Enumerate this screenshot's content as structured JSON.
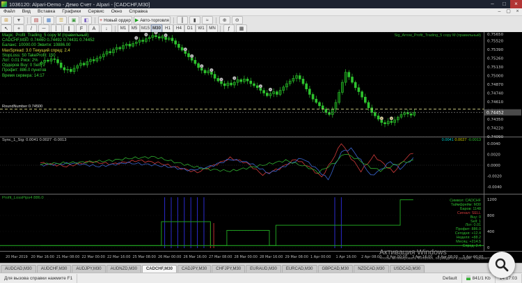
{
  "window": {
    "title": "1036120: Alpari-Demo - Демо Счет - Alpari - [CADCHF,M30]"
  },
  "menu": {
    "items": [
      "Файл",
      "Вид",
      "Вставка",
      "Графики",
      "Сервис",
      "Окно",
      "Справка"
    ]
  },
  "toolbar1": {
    "groups": [
      [
        {
          "n": "new-chart-button",
          "g": "⊞",
          "c": "#c9962f"
        },
        {
          "n": "profiles-button",
          "g": "▼",
          "c": "#666"
        }
      ],
      [
        {
          "n": "market-watch-button",
          "g": "▤",
          "c": "#b03030"
        },
        {
          "n": "data-window-button",
          "g": "▦",
          "c": "#3f7ac9"
        },
        {
          "n": "navigator-button",
          "g": "☰",
          "c": "#c9a52f"
        },
        {
          "n": "terminal-button",
          "g": "▣",
          "c": "#3f9a3f"
        },
        {
          "n": "strategy-tester-button",
          "g": "◧",
          "c": "#7a5fc0"
        }
      ],
      [
        {
          "n": "new-order-button",
          "g": "+",
          "c": "#c03030",
          "label": "Новый ордер"
        },
        {
          "n": "autotrade-button",
          "g": "▶",
          "c": "#18a018",
          "label": "Авто-торговля"
        }
      ],
      [
        {
          "n": "bars-chart-button",
          "g": "║",
          "c": "#444"
        },
        {
          "n": "candles-chart-button",
          "g": "▮",
          "c": "#444"
        },
        {
          "n": "line-chart-button",
          "g": "≈",
          "c": "#444"
        }
      ],
      [
        {
          "n": "zoom-in-button",
          "g": "⊕",
          "c": "#444"
        },
        {
          "n": "zoom-out-button",
          "g": "⊖",
          "c": "#444"
        }
      ]
    ]
  },
  "toolbar2": {
    "icons": [
      {
        "n": "cursor-button",
        "g": "↖"
      },
      {
        "n": "crosshair-button",
        "g": "+"
      },
      {
        "n": "trendline-button",
        "g": "/"
      },
      {
        "n": "hline-button",
        "g": "─"
      },
      {
        "n": "vline-button",
        "g": "│"
      },
      {
        "n": "channel-button",
        "g": "∥"
      },
      {
        "n": "fibonacci-button",
        "g": "F"
      },
      {
        "n": "text-button",
        "g": "A"
      },
      {
        "n": "arrows-button",
        "g": "↓"
      }
    ],
    "timeframes": [
      "M1",
      "M5",
      "M15",
      "M30",
      "H1",
      "H4",
      "D1",
      "W1",
      "MN"
    ],
    "active_timeframe": "M30",
    "right_icons": [
      {
        "n": "indicators-button",
        "g": "ƒ"
      },
      {
        "n": "templates-button",
        "g": "▦"
      }
    ]
  },
  "chart": {
    "overlay_lines": [
      {
        "text": "Magic_Profit_Trading_5 copy M (правильный)",
        "color": "#3ddc3d"
      },
      {
        "text": "CADCHF,M30: 0.74460 0.74492 0.74431 0.74452",
        "color": "#3ddc3d"
      },
      {
        "text": "Баланс: 10000.00  Эквити: 10886.00",
        "color": "#3ddc3d"
      },
      {
        "text": "MaxSpread: 3.0  Текущий спред: 2.4",
        "color": "#dede3c"
      },
      {
        "text": "StopLoss: 50  TakeProfit: 150",
        "color": "#3ddc3d"
      },
      {
        "text": "Лот: 0.01  Риск: 2%",
        "color": "#3ddc3d"
      },
      {
        "text": "Ордеров Buy: 0  Sell: 1",
        "color": "#3ddc3d"
      },
      {
        "text": "Профит: 886.0 пунктов",
        "color": "#3ddc3d"
      },
      {
        "text": "Время сервера: 14:17",
        "color": "#3ddc3d"
      }
    ],
    "top_right_label": "Sig_Arrow_Profit_Trading_5 copy M (правильный)",
    "round_line_label": "RoundNumber 0.74500",
    "round_line_price": 0.745,
    "current_price": "0.74452",
    "current_price_value": 0.74452,
    "price_ticks": [
      "0.75650",
      "0.75520",
      "0.75390",
      "0.75260",
      "0.75130",
      "0.75000",
      "0.74870",
      "0.74740",
      "0.74610",
      "0.74480",
      "0.74350",
      "0.74220",
      "0.74090"
    ],
    "price_max": 0.7565,
    "price_min": 0.7409,
    "time_ticks": [
      "20 Mar 2019",
      "20 Mar 16:00",
      "21 Mar 08:00",
      "22 Mar 00:00",
      "22 Mar 16:00",
      "25 Mar 08:00",
      "26 Mar 00:00",
      "26 Mar 16:00",
      "27 Mar 08:00",
      "28 Mar 00:00",
      "28 Mar 16:00",
      "29 Mar 08:00",
      "1 Apr 00:00",
      "1 Apr 16:00",
      "2 Apr 08:00",
      "3 Apr 00:00",
      "3 Apr 16:00",
      "4 Apr 08:00",
      "5 Apr 00:00"
    ],
    "closes": [
      0.752,
      0.7523,
      0.75215,
      0.7525,
      0.7524,
      0.7519,
      0.7512,
      0.75085,
      0.75095,
      0.7506,
      0.7511,
      0.7515,
      0.75185,
      0.7516,
      0.7521,
      0.7524,
      0.7522,
      0.7526,
      0.7528,
      0.7532,
      0.7536,
      0.7534,
      0.7539,
      0.7542,
      0.754,
      0.7545,
      0.7547,
      0.7544,
      0.7548,
      0.755,
      0.7553,
      0.7551,
      0.7555,
      0.7557,
      0.756,
      0.7558,
      0.7556,
      0.7559,
      0.7554,
      0.7556,
      0.7552,
      0.7547,
      0.7542,
      0.7538,
      0.7533,
      0.7528,
      0.7523,
      0.7518,
      0.7512,
      0.7508,
      0.7504,
      0.7507,
      0.7502,
      0.7496,
      0.7492,
      0.7488,
      0.7485,
      0.7489,
      0.7486,
      0.749,
      0.7494,
      0.7491,
      0.7495,
      0.7492,
      0.7488,
      0.7485,
      0.7482,
      0.7478,
      0.7474,
      0.747,
      0.7473,
      0.7476,
      0.7472,
      0.7478,
      0.7483,
      0.7488,
      0.7492,
      0.7496,
      0.75,
      0.7495,
      0.7488,
      0.748,
      0.7472,
      0.7465,
      0.746,
      0.7455,
      0.745,
      0.7445,
      0.7442,
      0.745,
      0.746,
      0.7475,
      0.749,
      0.7505,
      0.7498,
      0.749,
      0.7482,
      0.7476,
      0.7468,
      0.746,
      0.7452,
      0.7445,
      0.744,
      0.7435,
      0.743,
      0.7428,
      0.7432,
      0.743,
      0.7434,
      0.7438,
      0.7442,
      0.7445,
      0.7443,
      0.7441,
      0.74452
    ],
    "markers": [
      {
        "i": 29
      },
      {
        "i": 32
      },
      {
        "i": 35
      },
      {
        "i": 38
      },
      {
        "i": 44
      },
      {
        "i": 46
      },
      {
        "i": 49
      },
      {
        "i": 52
      },
      {
        "i": 55
      },
      {
        "i": 59
      },
      {
        "i": 67
      },
      {
        "i": 70
      },
      {
        "i": 104,
        "c": "gold"
      },
      {
        "i": 107,
        "c": "gold"
      }
    ],
    "candle_color": "#2ec22e",
    "marker_color": "#cfcfcf",
    "marker_gold": "#e8dc9a"
  },
  "win1": {
    "label": "Sync_1_Sig: 0.0041 0.0027 -0.0013",
    "values": [
      {
        "text": "0.0041",
        "color": "#00d0d0"
      },
      {
        "text": "0.0027",
        "color": "#d0d000"
      },
      {
        "text": "-0.0013",
        "color": "#30c030"
      }
    ],
    "ticks": [
      "0.0040",
      "0.0020",
      "0.0000",
      "-0.0020",
      "-0.0040"
    ],
    "series": {
      "red": [
        [
          0,
          0.1
        ],
        [
          8,
          -0.05
        ],
        [
          15,
          0.15
        ],
        [
          22,
          0.05
        ],
        [
          30,
          0.2
        ],
        [
          36,
          0.1
        ],
        [
          42,
          -0.1
        ],
        [
          48,
          -0.3
        ],
        [
          54,
          0.05
        ],
        [
          58,
          0.3
        ],
        [
          63,
          0.1
        ],
        [
          68,
          -0.4
        ],
        [
          73,
          -0.15
        ],
        [
          78,
          0.25
        ],
        [
          82,
          -0.05
        ],
        [
          86,
          -0.5
        ],
        [
          90,
          0.4
        ],
        [
          92,
          0.95
        ],
        [
          95,
          0.3
        ],
        [
          98,
          -0.25
        ],
        [
          102,
          0.4
        ],
        [
          105,
          0.05
        ],
        [
          108,
          -0.3
        ],
        [
          111,
          0.2
        ],
        [
          114,
          0.55
        ]
      ],
      "blue": [
        [
          0,
          0.0
        ],
        [
          10,
          0.08
        ],
        [
          18,
          -0.05
        ],
        [
          26,
          0.1
        ],
        [
          34,
          0.02
        ],
        [
          40,
          -0.08
        ],
        [
          46,
          -0.22
        ],
        [
          52,
          -0.05
        ],
        [
          58,
          0.25
        ],
        [
          64,
          0.1
        ],
        [
          70,
          -0.35
        ],
        [
          76,
          0.05
        ],
        [
          80,
          0.3
        ],
        [
          84,
          -0.1
        ],
        [
          88,
          -0.6
        ],
        [
          92,
          0.55
        ],
        [
          95,
          0.7
        ],
        [
          98,
          0.2
        ],
        [
          101,
          -0.45
        ],
        [
          104,
          -0.2
        ],
        [
          107,
          0.15
        ],
        [
          110,
          -0.15
        ],
        [
          114,
          0.3
        ]
      ],
      "green": [
        [
          0,
          0.05
        ],
        [
          12,
          0.12
        ],
        [
          20,
          0.18
        ],
        [
          28,
          0.3
        ],
        [
          35,
          0.35
        ],
        [
          42,
          0.1
        ],
        [
          50,
          -0.15
        ],
        [
          58,
          -0.25
        ],
        [
          66,
          -0.05
        ],
        [
          75,
          0.2
        ],
        [
          82,
          -0.1
        ],
        [
          85,
          -0.3
        ],
        [
          90,
          0.1
        ],
        [
          93,
          0.5
        ],
        [
          97,
          0.25
        ],
        [
          101,
          -0.1
        ],
        [
          104,
          -0.22
        ],
        [
          108,
          0.0
        ],
        [
          111,
          0.12
        ],
        [
          114,
          0.2
        ]
      ]
    },
    "colors": {
      "red": "#d23b3b",
      "blue": "#3b66d2",
      "green": "#2fae2f"
    }
  },
  "win2": {
    "label": "Profit_LossPips4 886.0",
    "ticks": [
      "1200",
      "800",
      "400",
      "0"
    ],
    "steps": [
      [
        0,
        0.05
      ],
      [
        37,
        0.05
      ],
      [
        37,
        0.52
      ],
      [
        52,
        0.52
      ],
      [
        52,
        0.05
      ],
      [
        57,
        0.05
      ],
      [
        57,
        0.35
      ],
      [
        70,
        0.35
      ],
      [
        70,
        0.05
      ],
      [
        72,
        0.05
      ],
      [
        72,
        0.45
      ],
      [
        110,
        0.45
      ],
      [
        110,
        0.95
      ],
      [
        114,
        0.95
      ]
    ],
    "baseline_level": 0.05,
    "blue_vlines": [
      38,
      40,
      42,
      44,
      46,
      48,
      50,
      90,
      92
    ],
    "red_vlines": [
      52,
      53
    ],
    "line_color": "#1f9e1f",
    "blue_color": "#2b2bd0",
    "red_color": "#c03030",
    "legend": [
      {
        "text": "Символ: CADCHF",
        "color": "#2fbf2f"
      },
      {
        "text": "Таймфрейм: M30",
        "color": "#2fbf2f"
      },
      {
        "text": "Баров: 1148",
        "color": "#2fbf2f"
      },
      {
        "text": "Сигнал: SELL",
        "color": "#d23b3b"
      },
      {
        "text": "Buy: 0",
        "color": "#2fbf2f"
      },
      {
        "text": "Sell: 1",
        "color": "#2fbf2f"
      },
      {
        "text": "Лот: 0.01",
        "color": "#2fbf2f"
      },
      {
        "text": "Профит: 886.0",
        "color": "#2fbf2f"
      },
      {
        "text": "Сегодня: +12.4",
        "color": "#2fbf2f"
      },
      {
        "text": "Неделя: +88.2",
        "color": "#2fbf2f"
      },
      {
        "text": "Месяц: +214.5",
        "color": "#2fbf2f"
      },
      {
        "text": "Спред: 2.4",
        "color": "#2fbf2f"
      }
    ]
  },
  "tabs": {
    "items": [
      "AUDCAD,M30",
      "AUDCHF,M30",
      "AUDJPY,M30",
      "AUDNZD,M30",
      "CADCHF,M30",
      "CADJPY,M30",
      "CHFJPY,M30",
      "EURAUD,M30",
      "EURCAD,M30",
      "GBPCAD,M30",
      "NZDCAD,M30",
      "USDCAD,M30"
    ],
    "active": "CADCHF,M30"
  },
  "status": {
    "help": "Для вызова справки нажмите F1",
    "profile": "Default",
    "traffic": "841/1 Kb",
    "time": "14:17:03"
  },
  "watermark": {
    "line1": "Активация Windows",
    "line2": "Чтобы активировать Windows, перейдите в раздел \"Параметры\"."
  }
}
